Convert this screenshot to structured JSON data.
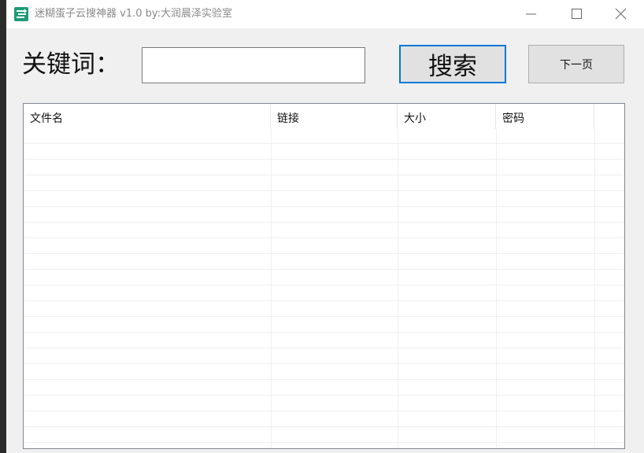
{
  "window": {
    "title": "迷糊蛋子云搜神器 v1.0   by:大润晨泽实验室"
  },
  "window_controls": {
    "minimize": "minimize-icon",
    "maximize": "maximize-icon",
    "close": "close-icon"
  },
  "search": {
    "keyword_label": "关键词：",
    "keyword_value": "",
    "search_button_label": "搜索",
    "next_page_button_label": "下一页"
  },
  "results_table": {
    "columns": [
      "文件名",
      "链接",
      "大小",
      "密码"
    ],
    "rows": []
  },
  "colors": {
    "accent": "#0078d7",
    "app_icon": "#1f9a78",
    "window_bg": "#f0f0f0"
  }
}
